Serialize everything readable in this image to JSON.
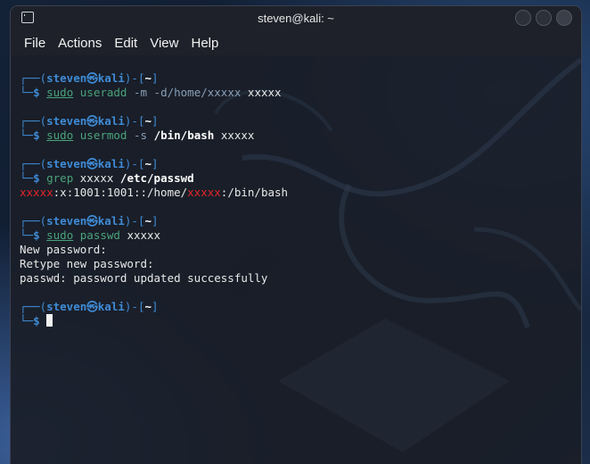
{
  "window": {
    "title": "steven@kali: ~"
  },
  "menu": [
    "File",
    "Actions",
    "Edit",
    "View",
    "Help"
  ],
  "prompt": {
    "user": "steven",
    "sep": "㉿",
    "host": "kali",
    "dir": "~"
  },
  "commands": [
    {
      "cmd": "sudo",
      "rest1": "useradd",
      "rest2": " -m -d/home/xxxxx ",
      "arg": "xxxxx"
    },
    {
      "cmd": "sudo",
      "rest1": "usermod",
      "rest2": " -s ",
      "arg_bold": "/bin/bash",
      "arg": " xxxxx"
    },
    {
      "cmd": "grep",
      "rest2": " xxxxx ",
      "arg_bold": "/etc/passwd"
    },
    {
      "cmd": "sudo",
      "rest1": "passwd",
      "arg": " xxxxx"
    }
  ],
  "grep_output": {
    "user": "xxxxx",
    "mid": ":x:1001:1001::/home/",
    "user2": "xxxxx",
    "tail": ":/bin/bash"
  },
  "passwd_output": [
    "New password:",
    "Retype new password:",
    "passwd: password updated successfully"
  ]
}
